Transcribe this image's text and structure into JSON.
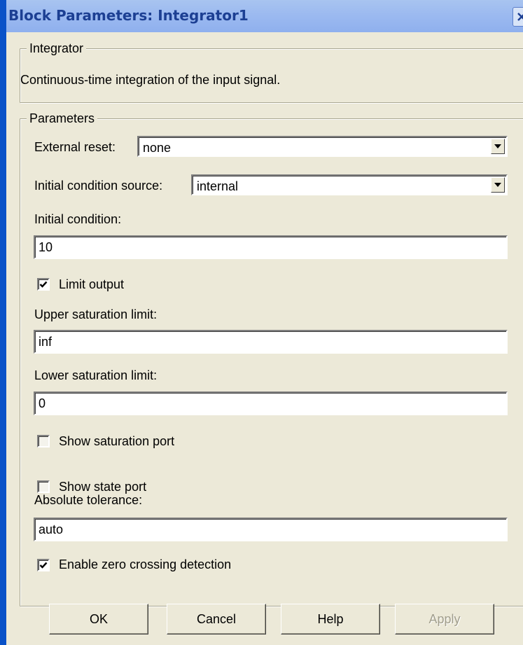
{
  "window": {
    "title": "Block Parameters: Integrator1"
  },
  "block": {
    "legend": "Integrator",
    "description": "Continuous-time integration of the input signal."
  },
  "parameters": {
    "legend": "Parameters",
    "external_reset": {
      "label": "External reset:",
      "value": "none"
    },
    "ic_source": {
      "label": "Initial condition source:",
      "value": "internal"
    },
    "initial_condition": {
      "label": "Initial condition:",
      "value": "10"
    },
    "limit_output": {
      "label": "Limit output",
      "checked": true
    },
    "upper_limit": {
      "label": "Upper saturation limit:",
      "value": "inf"
    },
    "lower_limit": {
      "label": "Lower saturation limit:",
      "value": "0"
    },
    "show_saturation_port": {
      "label": "Show saturation port",
      "checked": false
    },
    "show_state_port": {
      "label": "Show state port",
      "checked": false
    },
    "absolute_tolerance": {
      "label": "Absolute tolerance:",
      "value": "auto"
    },
    "zero_crossing": {
      "label": "Enable zero crossing detection",
      "checked": true
    }
  },
  "buttons": {
    "ok": "OK",
    "cancel": "Cancel",
    "help": "Help",
    "apply": "Apply"
  },
  "icons": {
    "close": "close-icon",
    "dropdown": "chevron-down-icon",
    "check": "checkmark-icon"
  },
  "colors": {
    "title_text": "#1c3f93",
    "dialog_bg": "#ece9d8",
    "disabled_text": "#a19e8c"
  }
}
